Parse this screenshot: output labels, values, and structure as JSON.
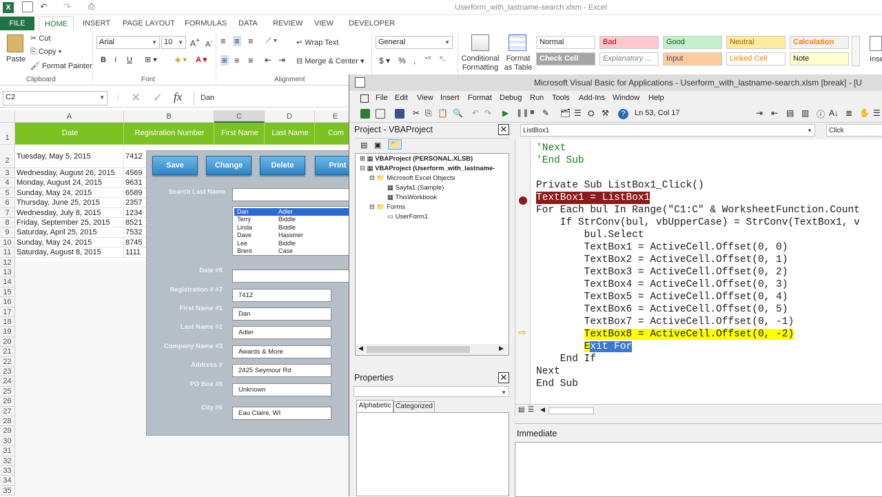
{
  "excel": {
    "title": "Userform_with_lastname-search.xlsm - Excel",
    "tabs": [
      "FILE",
      "HOME",
      "INSERT",
      "PAGE LAYOUT",
      "FORMULAS",
      "DATA",
      "REVIEW",
      "VIEW",
      "DEVELOPER"
    ],
    "ribbon": {
      "clipboard": {
        "paste": "Paste",
        "cut": "Cut",
        "copy": "Copy",
        "format_painter": "Format Painter",
        "label": "Clipboard"
      },
      "font": {
        "name": "Arial",
        "size": "10",
        "label": "Font"
      },
      "alignment": {
        "wrap": "Wrap Text",
        "merge": "Merge & Center",
        "label": "Alignment"
      },
      "number": {
        "format": "General",
        "label": "Number"
      },
      "conditional": "Conditional Formatting",
      "format_table": "Format as Table",
      "styles": [
        "Normal",
        "Bad",
        "Good",
        "Neutral",
        "Calculation",
        "Check Cell",
        "Explanatory ...",
        "Input",
        "Linked Cell",
        "Note"
      ],
      "insert": "Inse"
    },
    "name_box": "C2",
    "formula_value": "Dan",
    "columns": [
      "A",
      "B",
      "C",
      "D",
      "E"
    ],
    "headers": [
      "Date",
      "Registration Number",
      "First Name",
      "Last Name",
      "Com"
    ],
    "rows": [
      {
        "n": "2",
        "date": "Tuesday, May 5, 2015",
        "reg": "7412"
      },
      {
        "n": "3",
        "date": "Wednesday, August 26, 2015",
        "reg": "4569"
      },
      {
        "n": "4",
        "date": "Monday, August 24, 2015",
        "reg": "9631"
      },
      {
        "n": "5",
        "date": "Sunday, May 24, 2015",
        "reg": "6589"
      },
      {
        "n": "6",
        "date": "Thursday, June 25, 2015",
        "reg": "2357"
      },
      {
        "n": "7",
        "date": "Wednesday, July 8, 2015",
        "reg": "1234"
      },
      {
        "n": "8",
        "date": "Friday, September 25, 2015",
        "reg": "8521"
      },
      {
        "n": "9",
        "date": "Saturday, April 25, 2015",
        "reg": "7532"
      },
      {
        "n": "10",
        "date": "Sunday, May 24, 2015",
        "reg": "8745"
      },
      {
        "n": "11",
        "date": "Saturday, August 8, 2015",
        "reg": "1111"
      }
    ],
    "row_numbers_after": [
      "12",
      "13",
      "14",
      "15",
      "16",
      "17",
      "18",
      "19",
      "20",
      "21",
      "22",
      "23",
      "24",
      "25",
      "26",
      "27",
      "28",
      "29",
      "30",
      "31",
      "32",
      "33",
      "34",
      "35",
      "36"
    ],
    "row1": "1"
  },
  "userform": {
    "buttons": [
      "Save",
      "Change",
      "Delete",
      "Print"
    ],
    "search_label": "Search Last Name",
    "list": [
      [
        "Dan",
        "Adler"
      ],
      [
        "Terry",
        "Biddle"
      ],
      [
        "Linda",
        "Biddle"
      ],
      [
        "Dave",
        "Hassmer"
      ],
      [
        "Lee",
        "Biddle"
      ],
      [
        "Brent",
        "Case"
      ]
    ],
    "fields": [
      {
        "label": "Date #8",
        "value": ""
      },
      {
        "label": "Registration # #7",
        "value": "7412"
      },
      {
        "label": "First Name #1",
        "value": "Dan"
      },
      {
        "label": "Last Name #2",
        "value": "Adler"
      },
      {
        "label": "Company Name #3",
        "value": "Awards & More"
      },
      {
        "label": "Address #",
        "value": "2425 Seymour Rd"
      },
      {
        "label": "PO Box #5",
        "value": "Unknown"
      },
      {
        "label": "City #6",
        "value": "Eau Claire, WI"
      }
    ]
  },
  "vbe": {
    "title": "Microsoft Visual Basic for Applications - Userform_with_lastname-search.xlsm [break] - [U",
    "menu": [
      "File",
      "Edit",
      "View",
      "Insert",
      "Format",
      "Debug",
      "Run",
      "Tools",
      "Add-Ins",
      "Window",
      "Help"
    ],
    "position": "Ln 53, Col 17",
    "project_title": "Project - VBAProject",
    "tree": [
      "VBAProject (PERSONAL.XLSB)",
      "VBAProject (Userform_with_lastname-",
      "Microsoft Excel Objects",
      "Sayfa1 (Sample)",
      "ThisWorkbook",
      "Forms",
      "UserForm1"
    ],
    "properties_title": "Properties",
    "prop_tabs": [
      "Alphabetic",
      "Categorized"
    ],
    "object": "ListBox1",
    "procedure": "Click",
    "immediate": "Immediate",
    "code": [
      "'Next",
      "'End Sub",
      "",
      "Private Sub ListBox1_Click()",
      "TextBox1 = ListBox1",
      "For Each bul In Range(\"C1:C\" & WorksheetFunction.Count",
      "    If StrConv(bul, vbUpperCase) = StrConv(TextBox1, v",
      "        bul.Select",
      "        TextBox1 = ActiveCell.Offset(0, 0)",
      "        TextBox2 = ActiveCell.Offset(0, 1)",
      "        TextBox3 = ActiveCell.Offset(0, 2)",
      "        TextBox4 = ActiveCell.Offset(0, 3)",
      "        TextBox5 = ActiveCell.Offset(0, 4)",
      "        TextBox6 = ActiveCell.Offset(0, 5)",
      "        TextBox7 = ActiveCell.Offset(0, -1)",
      "        TextBox8 = ActiveCell.Offset(0, -2)",
      "        Exit For",
      "    End If",
      "Next",
      "End Sub"
    ]
  },
  "colors": {
    "excel_green": "#217346",
    "header_green": "#7dc223",
    "form_bg": "#b6bec8",
    "breakpoint": "#8b1a1a",
    "exec_highlight": "#ffff00"
  }
}
